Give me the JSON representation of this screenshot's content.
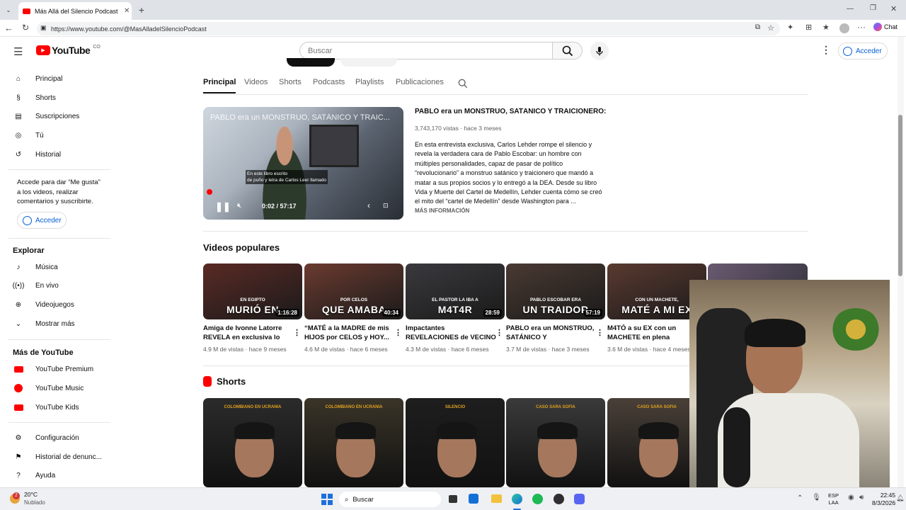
{
  "browser": {
    "tab_title": "Más Allá del Silencio Podcast - YouTube",
    "url": "https://www.youtube.com/@MasAlladelSilencioPodcast",
    "chat_label": "Chat"
  },
  "header": {
    "logo_text": "YouTube",
    "country": "CO",
    "search_placeholder": "Buscar",
    "signin": "Acceder"
  },
  "sidebar": {
    "main": [
      {
        "label": "Principal",
        "icon": "home-icon"
      },
      {
        "label": "Shorts",
        "icon": "shorts-icon"
      },
      {
        "label": "Suscripciones",
        "icon": "subscriptions-icon"
      },
      {
        "label": "Tú",
        "icon": "you-icon"
      },
      {
        "label": "Historial",
        "icon": "history-icon"
      }
    ],
    "signin_prompt": "Accede para dar “Me gusta” a los videos, realizar comentarios y suscribirte.",
    "signin_button": "Acceder",
    "explore_title": "Explorar",
    "explore": [
      {
        "label": "Música",
        "icon": "music-icon"
      },
      {
        "label": "En vivo",
        "icon": "live-icon"
      },
      {
        "label": "Videojuegos",
        "icon": "gaming-icon"
      },
      {
        "label": "Mostrar más",
        "icon": "chevron-down-icon"
      }
    ],
    "more_title": "Más de YouTube",
    "more": [
      {
        "label": "YouTube Premium",
        "icon": "yt-premium-icon"
      },
      {
        "label": "YouTube Music",
        "icon": "yt-music-icon"
      },
      {
        "label": "YouTube Kids",
        "icon": "yt-kids-icon"
      }
    ],
    "bottom": [
      {
        "label": "Configuración",
        "icon": "gear-icon"
      },
      {
        "label": "Historial de denunc...",
        "icon": "flag-icon"
      },
      {
        "label": "Ayuda",
        "icon": "help-icon"
      }
    ]
  },
  "channel_tabs": [
    "Principal",
    "Videos",
    "Shorts",
    "Podcasts",
    "Playlists",
    "Publicaciones"
  ],
  "featured": {
    "title": "PABLO era un MONSTRUO, SATÁNICO Y TRAICIONERO: Carlos...",
    "overlay_title": "PABLO era un MONSTRUO, SATÁNICO Y TRAIC...",
    "meta": "3,743,170 vistas · hace 3 meses",
    "description": "En esta entrevista exclusiva, Carlos Lehder rompe el silencio y revela la verdadera cara de Pablo Escobar: un hombre con múltiples personalidades, capaz de pasar de político “revolucionario” a monstruo satánico y traicionero que mandó a matar a sus propios socios y lo entregó a la DEA. Desde su libro Vida y Muerte del Cartel de Medellín, Lehder cuenta cómo se creó el mito del “cartel de Medellín” desde Washington para ...",
    "more": "MÁS INFORMACIÓN",
    "time": "0:02 / 57:17",
    "caption_l1": "En este libro escrito",
    "caption_l2": "de puño y letra de Carlos Leer llamado",
    "progress": 0.001
  },
  "popular": {
    "title": "Videos populares",
    "videos": [
      {
        "thumb_text": "MURIÓ EN",
        "thumb_sub": "EN EGIPTO",
        "duration": "1:16:28",
        "title": "Amiga de Ivonne Latorre REVELA en exclusiva lo que...",
        "meta": "4.9 M de vistas · hace 9 meses",
        "color": "#5a2a25"
      },
      {
        "thumb_text": "QUE AMABA",
        "thumb_sub": "POR CELOS",
        "duration": "40:34",
        "title": "“MATÉ a la MADRE de mis HIJOS por CELOS y HOY...",
        "meta": "4.6 M de vistas · hace 6 meses",
        "color": "#6b3b30"
      },
      {
        "thumb_text": "M4T4R",
        "thumb_sub": "EL PASTOR LA IBA A",
        "duration": "28:59",
        "title": "Impactantes REVELACIONES de VECINO que SALVÓ a...",
        "meta": "4.3 M de vistas · hace 6 meses",
        "color": "#3a3a3e"
      },
      {
        "thumb_text": "UN TRAIDOR",
        "thumb_sub": "PABLO ESCOBAR ERA",
        "duration": "57:19",
        "title": "PABLO era un MONSTRUO, SATÁNICO Y TRAICIONERO:...",
        "meta": "3.7 M de vistas · hace 3 meses",
        "color": "#4a3a32"
      },
      {
        "thumb_text": "MATÉ A MI EX",
        "thumb_sub": "CON UN MACHETE,",
        "duration": "",
        "title": "M4TÓ a su EX con un MACHETE en plena CALLE:...",
        "meta": "3.6 M de vistas · hace 4 meses",
        "color": "#5a3a30"
      }
    ]
  },
  "shorts": {
    "title": "Shorts",
    "items": [
      {
        "label": "COLOMBIANO EN UCRANIA",
        "color": "#2b2b2b"
      },
      {
        "label": "COLOMBIANO EN UCRANIA",
        "color": "#3a3428"
      },
      {
        "label": "SILENCIO",
        "color": "#1e1e1e"
      },
      {
        "label": "CASO SARA SOFIA",
        "color": "#3a3a3a"
      },
      {
        "label": "CASO SARA SOFIA",
        "color": "#4a4038"
      }
    ]
  },
  "taskbar": {
    "temp": "20°C",
    "weather": "Nublado",
    "search": "Buscar",
    "lang1": "ESP",
    "lang2": "LAA",
    "time": "22:45",
    "date": "8/3/2026",
    "weather_badge": "2"
  },
  "colors": {
    "yt_red": "#ff0000",
    "link_blue": "#065fd4",
    "accent": "#0f0f0f"
  }
}
